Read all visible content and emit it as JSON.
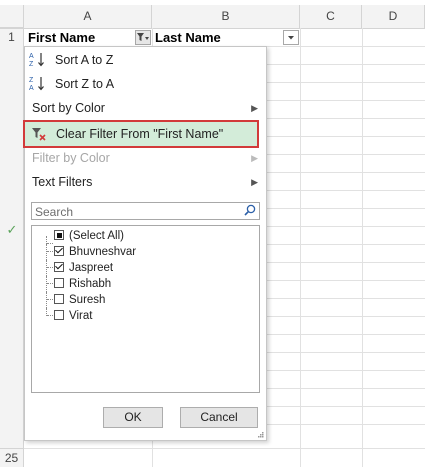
{
  "columns": {
    "a": "A",
    "b": "B",
    "c": "C",
    "d": "D"
  },
  "rows": {
    "first": "1",
    "last": "25"
  },
  "headers": {
    "first_name": "First Name",
    "last_name": "Last Name"
  },
  "menu": {
    "sort_az": "Sort A to Z",
    "sort_za": "Sort Z to A",
    "sort_color": "Sort by Color",
    "clear_filter": "Clear Filter From \"First Name\"",
    "filter_color": "Filter by Color",
    "text_filters": "Text Filters"
  },
  "search": {
    "placeholder": "Search"
  },
  "list": [
    {
      "label": "(Select All)",
      "state": "partial"
    },
    {
      "label": "Bhuvneshvar",
      "state": "checked"
    },
    {
      "label": "Jaspreet",
      "state": "checked"
    },
    {
      "label": "Rishabh",
      "state": "unchecked"
    },
    {
      "label": "Suresh",
      "state": "unchecked"
    },
    {
      "label": "Virat",
      "state": "unchecked"
    }
  ],
  "buttons": {
    "ok": "OK",
    "cancel": "Cancel"
  },
  "colors": {
    "highlight_fill": "#d3ecd9",
    "highlight_border": "#d23a3a"
  }
}
